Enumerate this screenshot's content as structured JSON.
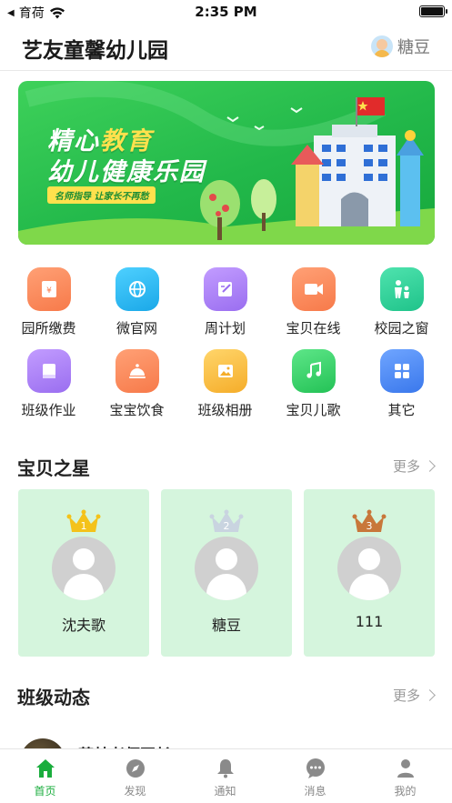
{
  "status_bar": {
    "carrier": "育荷",
    "time": "2:35 PM"
  },
  "header": {
    "school_name": "艺友童馨幼儿园",
    "user_name": "糖豆"
  },
  "banner": {
    "title_line1_a": "精心",
    "title_line1_b": "教育",
    "title_line2": "幼儿健康乐园",
    "tagline": "名师指导 让家长不再愁"
  },
  "menu": [
    {
      "label": "园所缴费",
      "icon": "payment-icon",
      "color": "#f7845a"
    },
    {
      "label": "微官网",
      "icon": "globe-icon",
      "color": "#2ab6ee"
    },
    {
      "label": "周计划",
      "icon": "edit-note-icon",
      "color": "#a57bf0"
    },
    {
      "label": "宝贝在线",
      "icon": "video-camera-icon",
      "color": "#f7845a"
    },
    {
      "label": "校园之窗",
      "icon": "parent-child-icon",
      "color": "#2fcf95"
    },
    {
      "label": "班级作业",
      "icon": "book-icon",
      "color": "#a57bf0"
    },
    {
      "label": "宝宝饮食",
      "icon": "food-cloche-icon",
      "color": "#f7845a"
    },
    {
      "label": "班级相册",
      "icon": "photo-icon",
      "color": "#f7bb3a"
    },
    {
      "label": "宝贝儿歌",
      "icon": "music-note-icon",
      "color": "#35cf68"
    },
    {
      "label": "其它",
      "icon": "grid-icon",
      "color": "#4f8cf0"
    }
  ],
  "stars": {
    "title": "宝贝之星",
    "more": "更多",
    "items": [
      {
        "rank": "1",
        "name": "沈夫歌",
        "crown_color": "#f4c21a"
      },
      {
        "rank": "2",
        "name": "糖豆",
        "crown_color": "#c9d4e0"
      },
      {
        "rank": "3",
        "name": "111",
        "crown_color": "#c8773a"
      }
    ]
  },
  "class_feed": {
    "title": "班级动态",
    "more": "更多",
    "first_post_author": "范林老师园长"
  },
  "tabbar": [
    {
      "label": "首页",
      "icon": "home-icon",
      "active": true
    },
    {
      "label": "发现",
      "icon": "compass-icon",
      "active": false
    },
    {
      "label": "通知",
      "icon": "bell-icon",
      "active": false
    },
    {
      "label": "消息",
      "icon": "message-icon",
      "active": false
    },
    {
      "label": "我的",
      "icon": "profile-icon",
      "active": false
    }
  ]
}
